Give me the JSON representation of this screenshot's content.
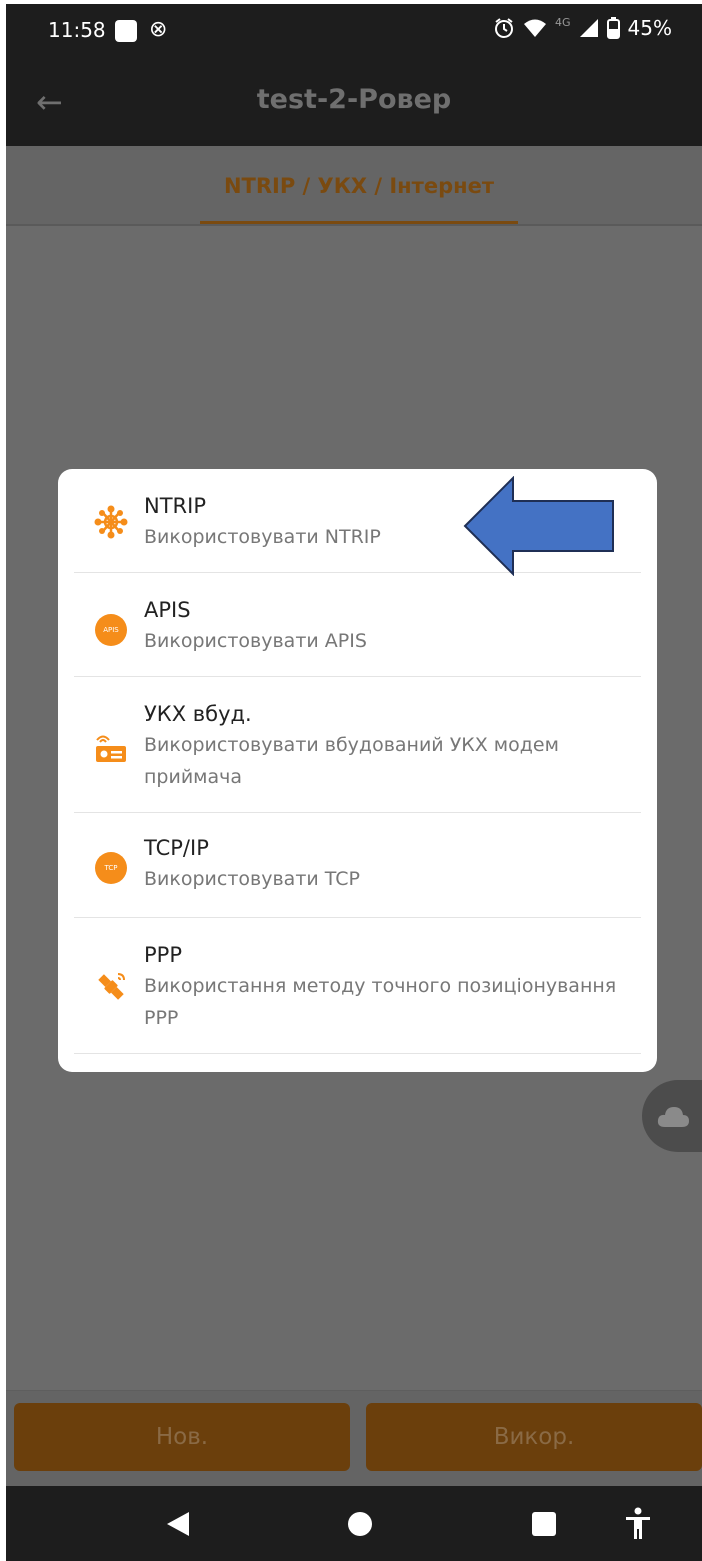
{
  "status_bar": {
    "time": "11:58",
    "network": "4G",
    "battery": "45%"
  },
  "app_bar": {
    "title": "test-2-Ровер"
  },
  "tabs": [
    {
      "label": "NTRIP / УКХ / Інтернет"
    }
  ],
  "dialog": {
    "options": [
      {
        "title": "NTRIP",
        "description": "Використовувати NTRIP",
        "icon": "network-nodes-icon"
      },
      {
        "title": "APIS",
        "description": "Використовувати APIS",
        "icon": "apis-badge-icon",
        "badge": "APIS"
      },
      {
        "title": "УКХ вбуд.",
        "description": "Використовувати вбудований УКХ модем приймача",
        "icon": "radio-modem-icon"
      },
      {
        "title": "TCP/IP",
        "description": "Використовувати TCP",
        "icon": "tcp-badge-icon",
        "badge": "TCP"
      },
      {
        "title": "PPP",
        "description": "Використання методу точного позиціонування PPP",
        "icon": "satellite-icon"
      }
    ]
  },
  "buttons": {
    "new_label": "Нов.",
    "use_label": "Викор."
  },
  "colors": {
    "accent": "#f58d1a",
    "annotation_arrow": "#4472c4",
    "overlay": "#6b6b6b"
  }
}
